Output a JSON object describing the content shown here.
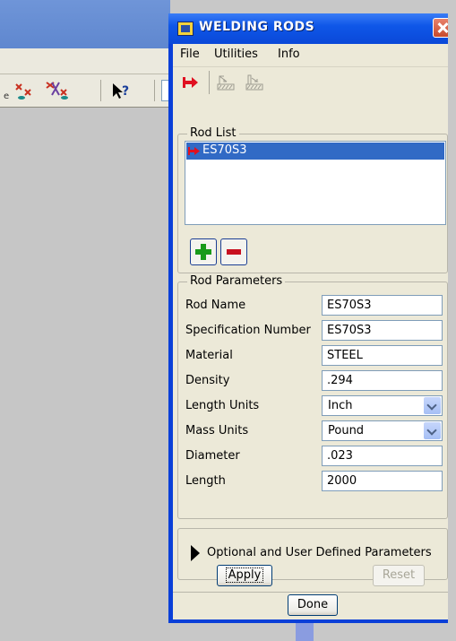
{
  "dialog": {
    "title": "WELDING RODS",
    "close_icon": "close-icon"
  },
  "menu": {
    "items": [
      "File",
      "Utilities",
      "Info"
    ]
  },
  "toolbar": {
    "icons": [
      "red-arrow-icon",
      "rod-edit-icon",
      "rod-copy-icon"
    ]
  },
  "rod_list": {
    "label": "Rod List",
    "items": [
      {
        "name": "ES70S3",
        "icon": "red-arrow-icon",
        "selected": true
      }
    ]
  },
  "rod_parameters": {
    "label": "Rod Parameters",
    "fields": [
      {
        "label": "Rod Name",
        "value": "ES70S3",
        "type": "text"
      },
      {
        "label": "Specification Number",
        "value": "ES70S3",
        "type": "text"
      },
      {
        "label": "Material",
        "value": "STEEL",
        "type": "text"
      },
      {
        "label": "Density",
        "value": ".294",
        "type": "text"
      },
      {
        "label": "Length Units",
        "value": "Inch",
        "type": "select"
      },
      {
        "label": "Mass Units",
        "value": "Pound",
        "type": "select"
      },
      {
        "label": "Diameter",
        "value": ".023",
        "type": "text"
      },
      {
        "label": "Length",
        "value": "2000",
        "type": "text"
      }
    ]
  },
  "optional": {
    "label": "Optional and User Defined Parameters"
  },
  "buttons": {
    "apply": "Apply",
    "reset": "Reset",
    "done": "Done"
  },
  "colors": {
    "titlebar": "#0a48d8",
    "selection": "#316ac5",
    "dialog_face": "#ece9d8",
    "accent_red": "#e01020",
    "accent_green": "#1a9a1a"
  }
}
